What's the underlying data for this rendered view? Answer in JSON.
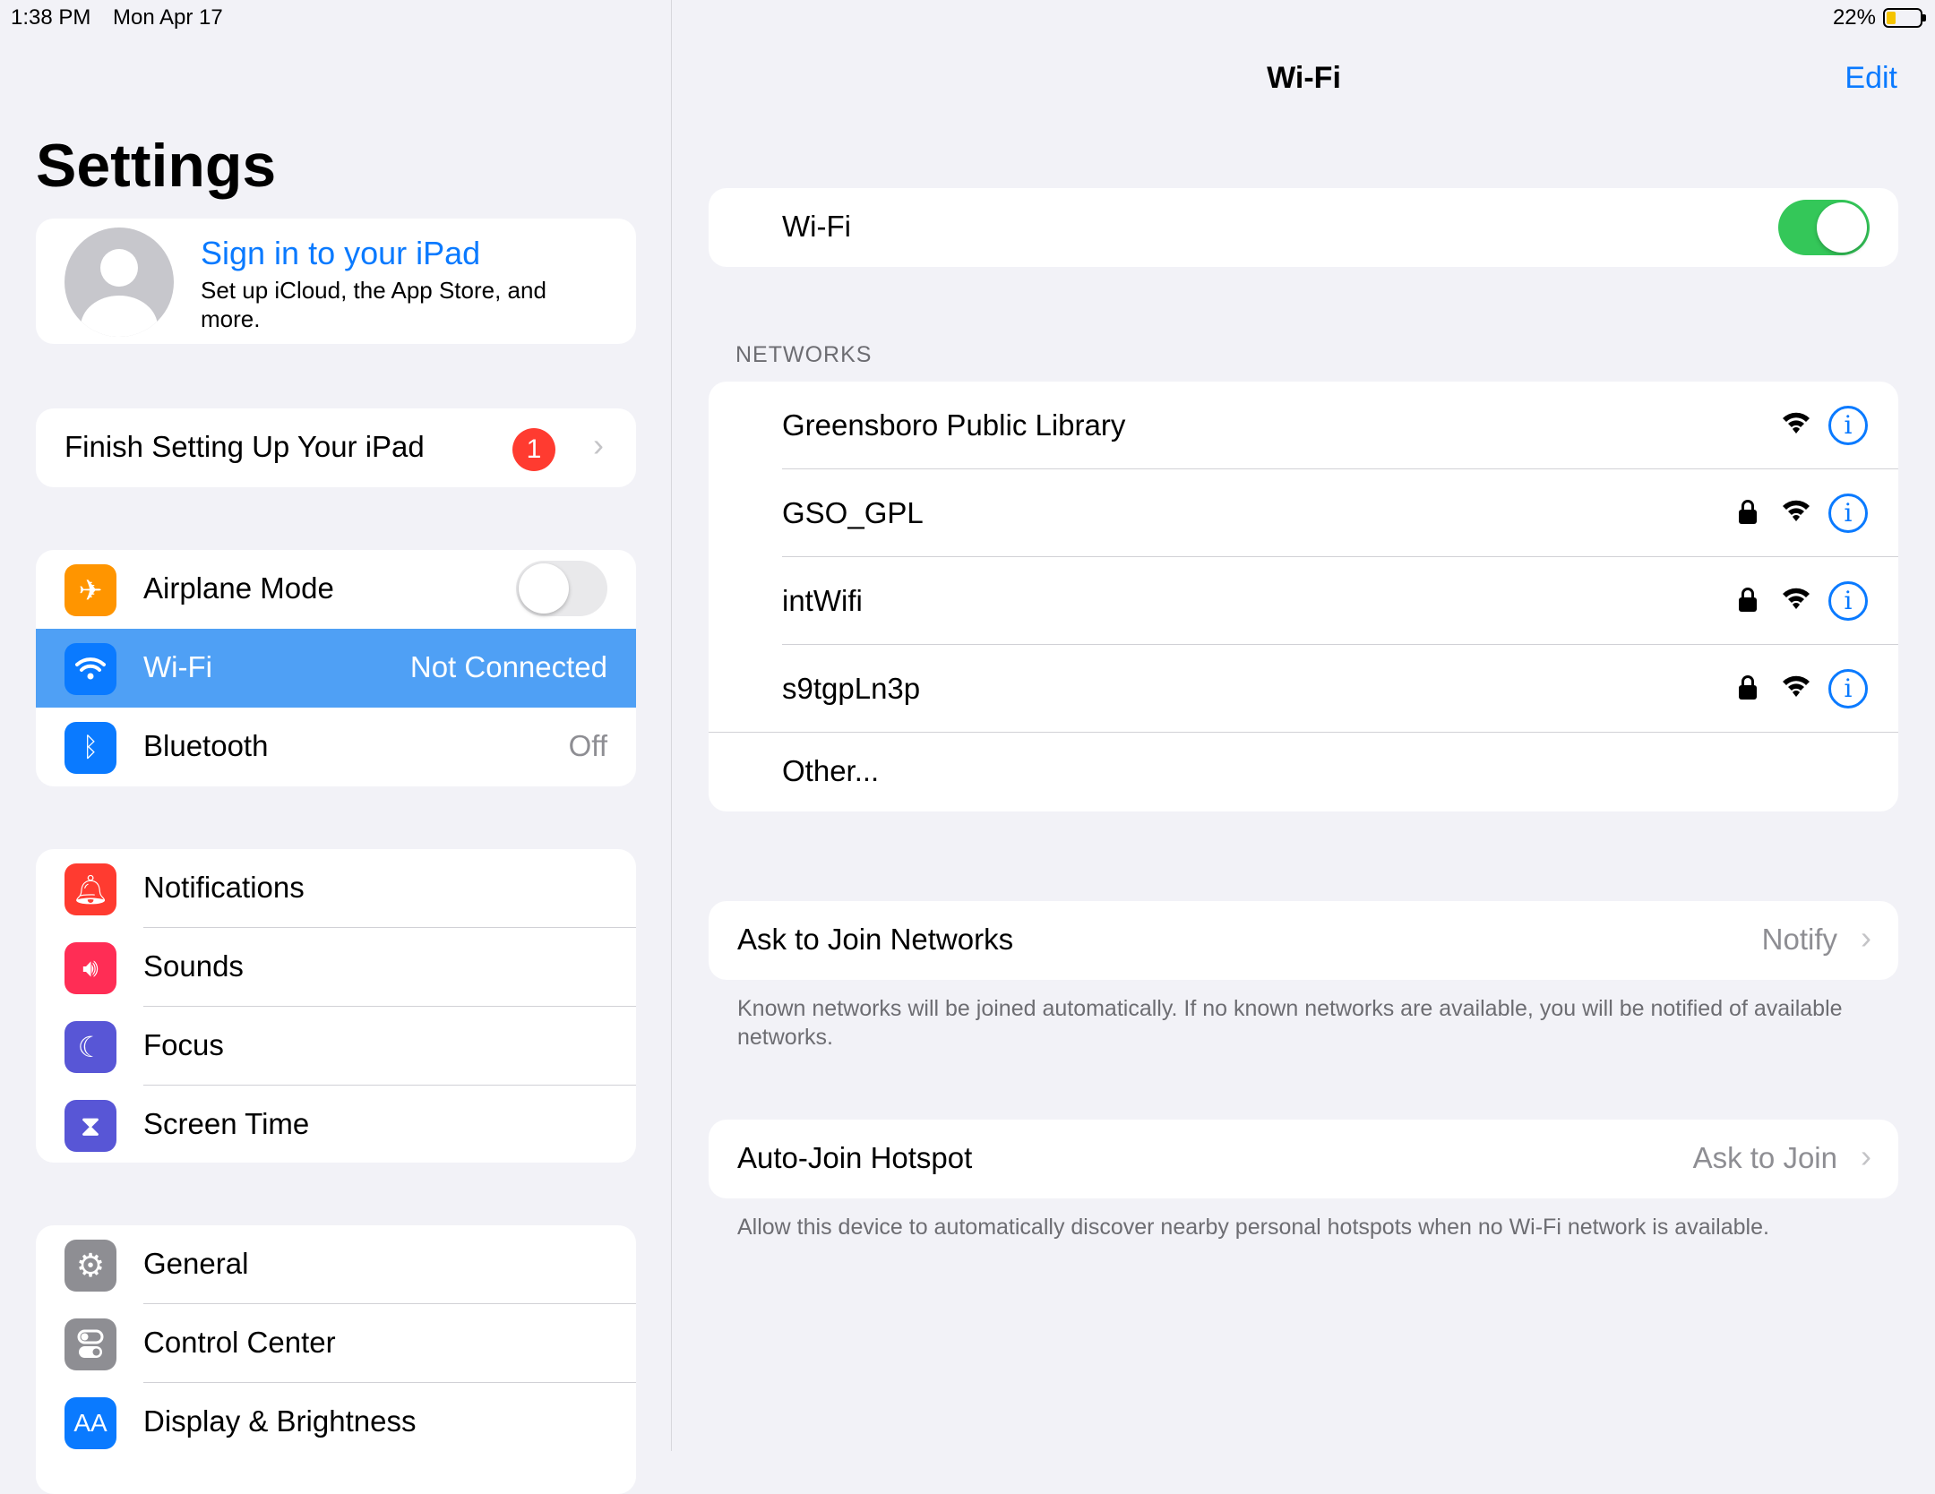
{
  "status_bar": {
    "time": "1:38 PM",
    "date": "Mon Apr 17",
    "battery": "22%"
  },
  "sidebar": {
    "title": "Settings",
    "profile": {
      "signin": "Sign in to your iPad",
      "subtitle": "Set up iCloud, the App Store, and more."
    },
    "finish_setup": {
      "label": "Finish Setting Up Your iPad",
      "badge": "1"
    },
    "connectivity": [
      {
        "label": "Airplane Mode",
        "icon": "airplane-icon",
        "color": "#ff9500",
        "toggle": false
      },
      {
        "label": "Wi-Fi",
        "value": "Not Connected",
        "icon": "wifi-icon",
        "color": "#0a7aff",
        "selected": true
      },
      {
        "label": "Bluetooth",
        "value": "Off",
        "icon": "bluetooth-icon",
        "color": "#0a7aff"
      }
    ],
    "group2": [
      {
        "label": "Notifications",
        "icon": "bell-icon",
        "color": "#ff3b30"
      },
      {
        "label": "Sounds",
        "icon": "speaker-icon",
        "color": "#ff2d55"
      },
      {
        "label": "Focus",
        "icon": "moon-icon",
        "color": "#5856d6"
      },
      {
        "label": "Screen Time",
        "icon": "hourglass-icon",
        "color": "#5856d6"
      }
    ],
    "group3": [
      {
        "label": "General",
        "icon": "gear-icon",
        "color": "#8e8e93"
      },
      {
        "label": "Control Center",
        "icon": "switches-icon",
        "color": "#8e8e93"
      },
      {
        "label": "Display & Brightness",
        "icon": "text-size-icon",
        "icon_text": "AA",
        "color": "#0a7aff"
      }
    ]
  },
  "detail": {
    "title": "Wi-Fi",
    "edit": "Edit",
    "wifi_toggle": {
      "label": "Wi-Fi",
      "on": true
    },
    "networks_header": "NETWORKS",
    "networks": [
      {
        "name": "Greensboro Public Library",
        "locked": false
      },
      {
        "name": "GSO_GPL",
        "locked": true
      },
      {
        "name": "intWifi",
        "locked": true
      },
      {
        "name": "s9tgpLn3p",
        "locked": true
      }
    ],
    "other": "Other...",
    "ask_to_join": {
      "label": "Ask to Join Networks",
      "value": "Notify",
      "footnote": "Known networks will be joined automatically. If no known networks are available, you will be notified of available networks."
    },
    "auto_join": {
      "label": "Auto-Join Hotspot",
      "value": "Ask to Join",
      "footnote": "Allow this device to automatically discover nearby personal hotspots when no Wi-Fi network is available."
    }
  }
}
